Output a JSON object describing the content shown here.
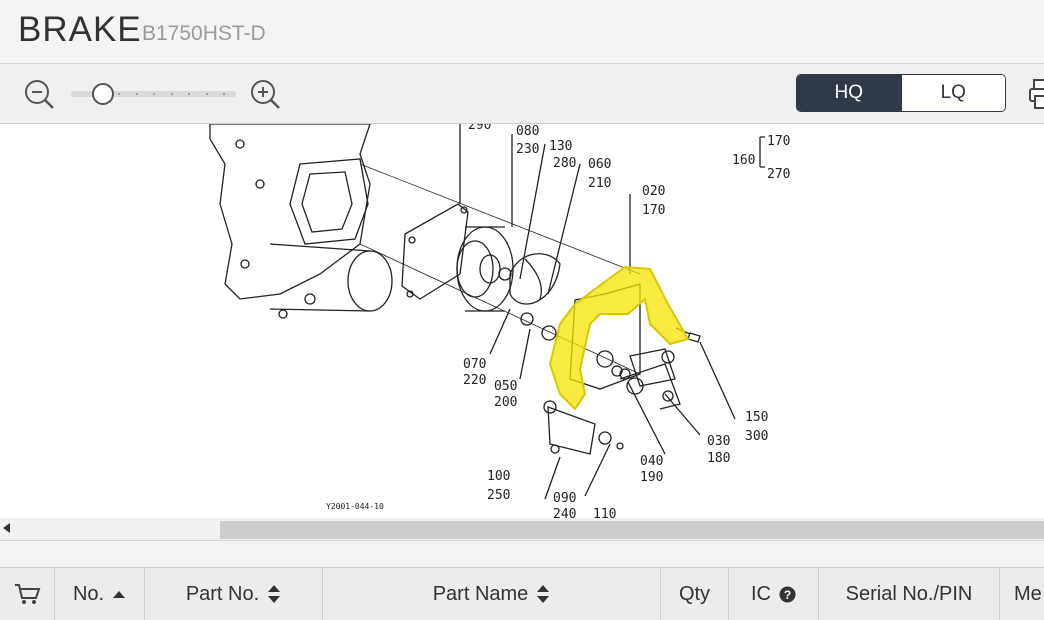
{
  "header": {
    "title": "BRAKE",
    "model": "B1750HST-D"
  },
  "toolbar": {
    "zoom_out_icon": "zoom-out-icon",
    "zoom_in_icon": "zoom-in-icon",
    "zoom_level": 0.15,
    "quality": {
      "options": [
        "HQ",
        "LQ"
      ],
      "selected": "HQ"
    },
    "print_icon": "print-icon"
  },
  "diagram": {
    "figure_id": "Y2001-044-10",
    "callouts": [
      "290",
      "080",
      "230",
      "130",
      "280",
      "060",
      "210",
      "020",
      "170",
      "160",
      "170",
      "270",
      "070",
      "220",
      "050",
      "200",
      "100",
      "250",
      "090",
      "240",
      "110",
      "040",
      "190",
      "030",
      "180",
      "150",
      "300"
    ],
    "highlight_color": "#f5e300"
  },
  "table": {
    "columns": [
      {
        "label": "",
        "icon": "cart-icon"
      },
      {
        "label": "No.",
        "sort": "ascending"
      },
      {
        "label": "Part No.",
        "sort": "both"
      },
      {
        "label": "Part Name",
        "sort": "both"
      },
      {
        "label": "Qty"
      },
      {
        "label": "IC",
        "icon": "help-icon"
      },
      {
        "label": "Serial No./PIN"
      },
      {
        "label": "Me"
      }
    ]
  }
}
